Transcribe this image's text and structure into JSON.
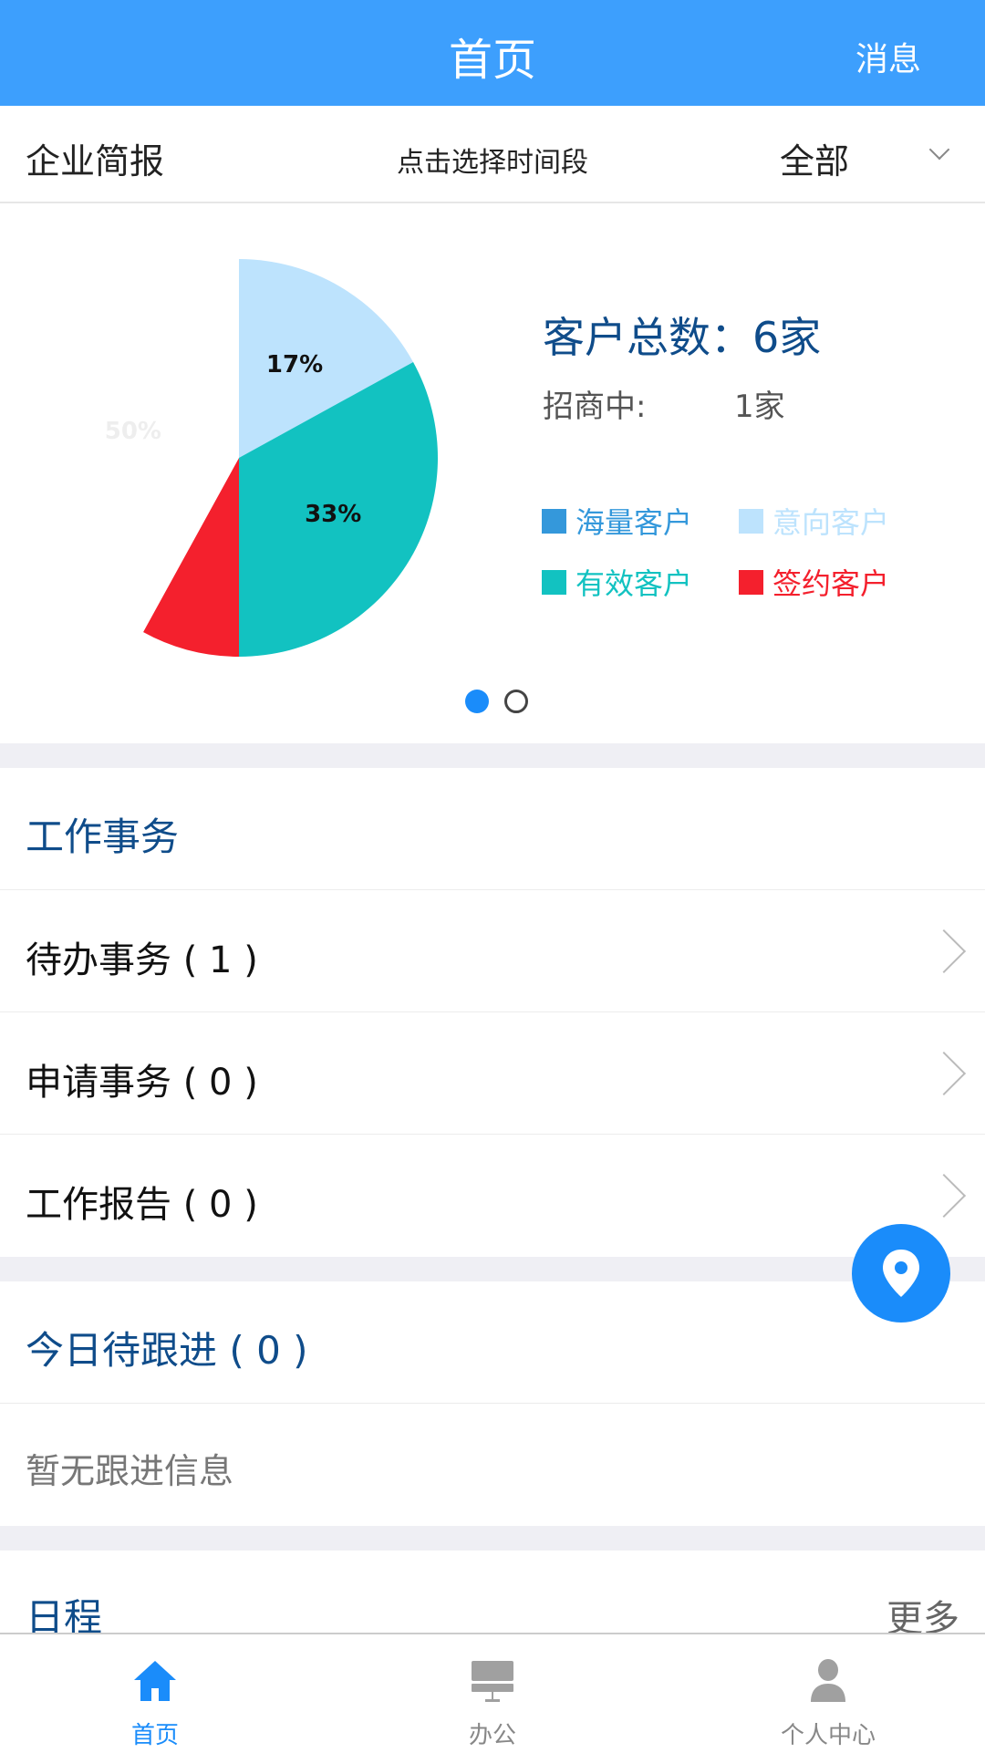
{
  "header": {
    "title": "首页",
    "messages": "消息"
  },
  "filter": {
    "section": "企业简报",
    "time_picker": "点击选择时间段",
    "scope": "全部"
  },
  "summary": {
    "total_label": "客户总数：6家",
    "inviting_label": "招商中:",
    "inviting_value": "1家"
  },
  "chart_data": {
    "type": "pie",
    "slices": [
      {
        "name": "意向客户",
        "value": 17,
        "label": "17%",
        "color": "#bde3fd"
      },
      {
        "name": "有效客户",
        "value": 33,
        "label": "33%",
        "color": "#12c2c1"
      },
      {
        "name": "签约客户",
        "value": 8,
        "label": "",
        "color": "#f4202d"
      },
      {
        "name": "海量客户",
        "value": 50,
        "label": "50%",
        "color": "#ffffff"
      }
    ],
    "legend": [
      {
        "name": "海量客户",
        "color": "#3498db"
      },
      {
        "name": "意向客户",
        "color": "#bde3fd"
      },
      {
        "name": "有效客户",
        "color": "#12c2c1"
      },
      {
        "name": "签约客户",
        "color": "#f4202d"
      }
    ],
    "legend_position": "right"
  },
  "pager": {
    "active_page": 1,
    "pages": 2
  },
  "work": {
    "title": "工作事务",
    "items": [
      {
        "label": "待办事务 ( 1 )"
      },
      {
        "label": "申请事务 ( 0 )"
      },
      {
        "label": "工作报告 ( 0 )"
      }
    ]
  },
  "followup": {
    "title": "今日待跟进 ( 0 )",
    "empty": "暂无跟进信息"
  },
  "schedule": {
    "title": "日程",
    "more": "更多"
  },
  "tabs": [
    {
      "label": "首页",
      "icon": "home-icon",
      "active": true
    },
    {
      "label": "办公",
      "icon": "office-icon",
      "active": false
    },
    {
      "label": "个人中心",
      "icon": "person-icon",
      "active": false
    }
  ],
  "colors": {
    "primary": "#3d9ffd",
    "accent": "#1a8cfa",
    "heading": "#0f4c8a"
  }
}
